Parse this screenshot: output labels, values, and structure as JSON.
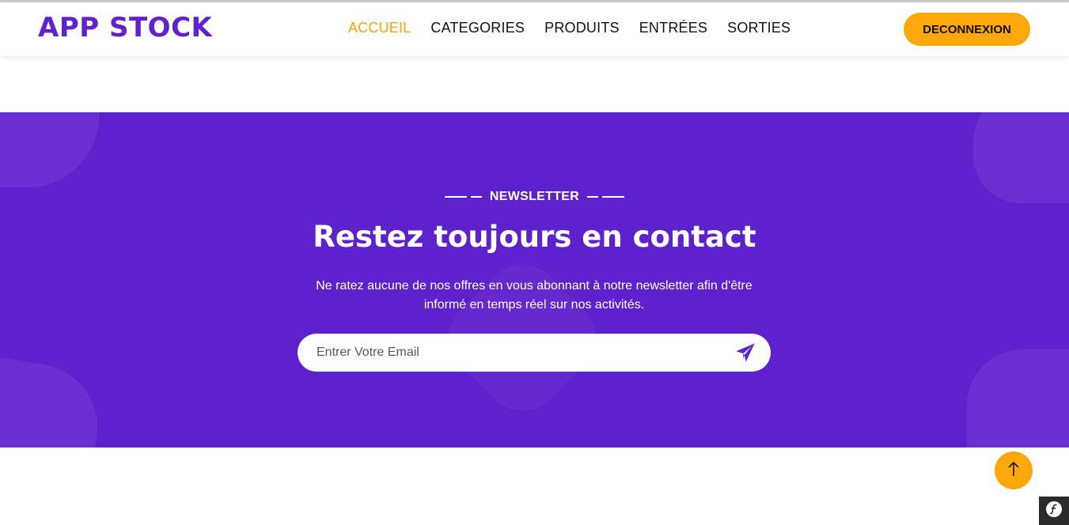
{
  "header": {
    "logo": "APP STOCK",
    "nav": [
      "ACCUEIL",
      "CATEGORIES",
      "PRODUITS",
      "ENTRÉES",
      "SORTIES"
    ],
    "active_nav": "ACCUEIL",
    "logout_label": "DECONNEXION"
  },
  "newsletter": {
    "eyebrow": "NEWSLETTER",
    "title": "Restez toujours en contact",
    "description": "Ne ratez aucune de nos offres en vous abonnant à notre newsletter afin d'être informé en temps réel sur nos activités.",
    "email_placeholder": "Entrer Votre Email",
    "email_value": ""
  },
  "icons": {
    "send": "paper-plane-icon",
    "back_to_top": "arrow-up-icon",
    "debug_toolbar": "symfony-icon"
  },
  "colors": {
    "brand_purple": "#5e22cc",
    "accent_orange": "#fca70a",
    "active_nav": "#f8a400"
  }
}
